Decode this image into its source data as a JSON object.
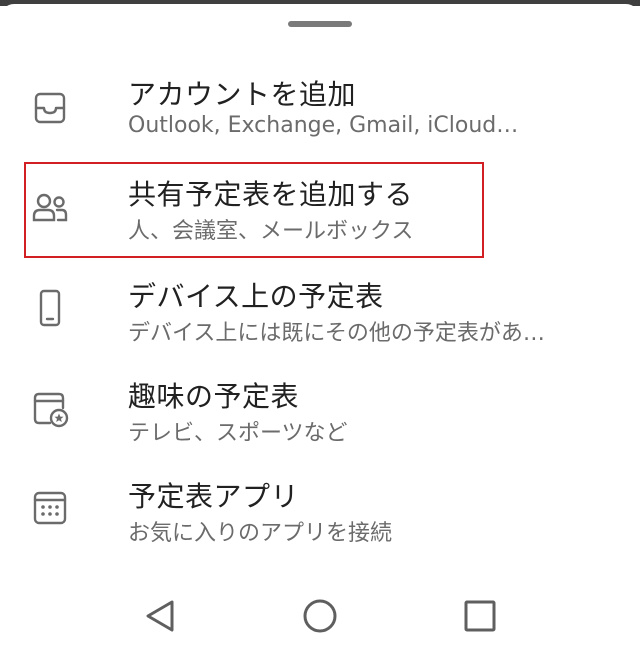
{
  "menu": {
    "items": [
      {
        "title": "アカウントを追加",
        "subtitle": "Outlook, Exchange, Gmail, iCloud…",
        "icon": "inbox-tray-icon"
      },
      {
        "title": "共有予定表を追加する",
        "subtitle": "人、会議室、メールボックス",
        "icon": "people-icon"
      },
      {
        "title": "デバイス上の予定表",
        "subtitle": "デバイス上には既にその他の予定表があ…",
        "icon": "phone-icon"
      },
      {
        "title": "趣味の予定表",
        "subtitle": "テレビ、スポーツなど",
        "icon": "calendar-star-icon"
      },
      {
        "title": "予定表アプリ",
        "subtitle": "お気に入りのアプリを接続",
        "icon": "calendar-grid-icon"
      }
    ]
  },
  "colors": {
    "highlight": "#d21f24",
    "title_text": "#212121",
    "subtitle_text": "#6b6b6b",
    "icon": "#6b6b6b"
  },
  "nav": {
    "back_icon": "triangle-back-icon",
    "home_icon": "circle-home-icon",
    "recents_icon": "square-recents-icon"
  }
}
